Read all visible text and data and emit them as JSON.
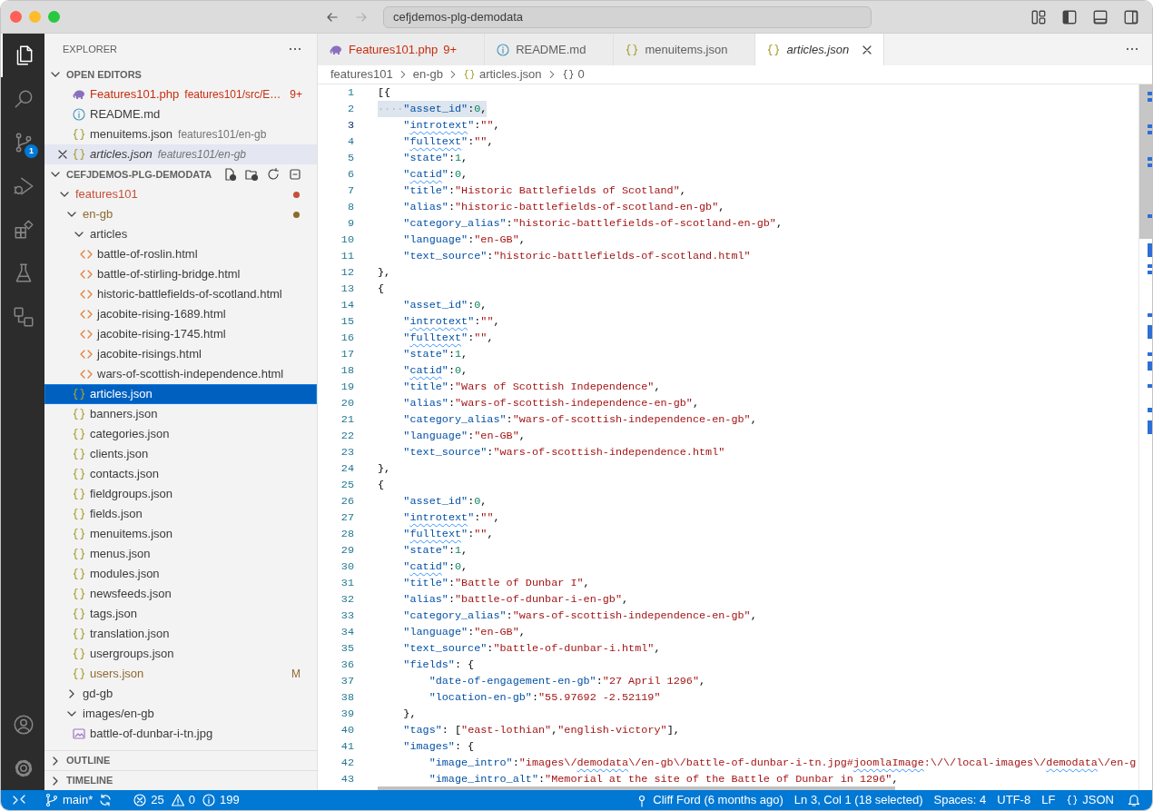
{
  "title_bar": {
    "back": {
      "disabled": false
    },
    "forward": {
      "disabled": true
    },
    "command_center": "cefjdemos-plg-demodata",
    "layout_controls": [
      {
        "kind": "customize",
        "on": false
      },
      {
        "kind": "primary-sidebar",
        "on": true
      },
      {
        "kind": "panel",
        "on": false
      },
      {
        "kind": "secondary-sidebar",
        "on": false
      }
    ]
  },
  "activity_bar": {
    "items": [
      {
        "kind": "explorer",
        "selected": true
      },
      {
        "kind": "search",
        "selected": false
      },
      {
        "kind": "source-control",
        "selected": false,
        "badge": "1"
      },
      {
        "kind": "run-debug",
        "selected": false
      },
      {
        "kind": "extensions",
        "selected": false
      },
      {
        "kind": "testing",
        "selected": false
      },
      {
        "kind": "remote-explorer",
        "selected": false
      }
    ],
    "bottom": [
      {
        "kind": "accounts"
      },
      {
        "kind": "manage"
      }
    ]
  },
  "sidebar": {
    "title": "EXPLORER",
    "open_editors": {
      "title": "OPEN EDITORS",
      "expanded": true,
      "items": [
        {
          "name": "Features101.php",
          "path": "features101/src/E…",
          "kind": "php",
          "badge": "9+",
          "color": "#c72e0f",
          "selected": false,
          "preview": false
        },
        {
          "name": "README.md",
          "kind": "info",
          "selected": false,
          "preview": false
        },
        {
          "name": "menuitems.json",
          "path": "features101/en-gb",
          "kind": "json",
          "selected": false,
          "preview": false
        },
        {
          "name": "articles.json",
          "path": "features101/en-gb",
          "kind": "json",
          "selected": true,
          "preview": true
        }
      ]
    },
    "folder": {
      "title": "CEFJDEMOS-PLG-DEMODATA",
      "expanded": true,
      "items": [
        {
          "label": "features101",
          "kind": "folder",
          "expanded": true,
          "selected": false,
          "color": "#c74e39",
          "children": [
            {
              "label": "en-gb",
              "kind": "folder",
              "expanded": true,
              "selected": false,
              "color": "#8f6a2d",
              "children": [
                {
                  "label": "articles",
                  "kind": "folder",
                  "expanded": true,
                  "selected": false,
                  "children": [
                    {
                      "label": "battle-of-roslin.html",
                      "kind": "html",
                      "selected": false
                    },
                    {
                      "label": "battle-of-stirling-bridge.html",
                      "kind": "html",
                      "selected": false
                    },
                    {
                      "label": "historic-battlefields-of-scotland.html",
                      "kind": "html",
                      "selected": false
                    },
                    {
                      "label": "jacobite-rising-1689.html",
                      "kind": "html",
                      "selected": false
                    },
                    {
                      "label": "jacobite-rising-1745.html",
                      "kind": "html",
                      "selected": false
                    },
                    {
                      "label": "jacobite-risings.html",
                      "kind": "html",
                      "selected": false
                    },
                    {
                      "label": "wars-of-scottish-independence.html",
                      "kind": "html",
                      "selected": false
                    }
                  ]
                },
                {
                  "label": "articles.json",
                  "kind": "json",
                  "selected": true
                },
                {
                  "label": "banners.json",
                  "kind": "json",
                  "selected": false
                },
                {
                  "label": "categories.json",
                  "kind": "json",
                  "selected": false
                },
                {
                  "label": "clients.json",
                  "kind": "json",
                  "selected": false
                },
                {
                  "label": "contacts.json",
                  "kind": "json",
                  "selected": false
                },
                {
                  "label": "fieldgroups.json",
                  "kind": "json",
                  "selected": false
                },
                {
                  "label": "fields.json",
                  "kind": "json",
                  "selected": false
                },
                {
                  "label": "menuitems.json",
                  "kind": "json",
                  "selected": false
                },
                {
                  "label": "menus.json",
                  "kind": "json",
                  "selected": false
                },
                {
                  "label": "modules.json",
                  "kind": "json",
                  "selected": false
                },
                {
                  "label": "newsfeeds.json",
                  "kind": "json",
                  "selected": false
                },
                {
                  "label": "tags.json",
                  "kind": "json",
                  "selected": false
                },
                {
                  "label": "translation.json",
                  "kind": "json",
                  "selected": false
                },
                {
                  "label": "usergroups.json",
                  "kind": "json",
                  "selected": false
                },
                {
                  "label": "users.json",
                  "kind": "json",
                  "selected": false,
                  "color": "#8f6a2d",
                  "badge": "M"
                }
              ]
            },
            {
              "label": "gd-gb",
              "kind": "folder",
              "expanded": false,
              "selected": false
            },
            {
              "label": "images/en-gb",
              "kind": "folder",
              "expanded": true,
              "selected": false,
              "children": [
                {
                  "label": "battle-of-dunbar-i-tn.jpg",
                  "kind": "image",
                  "selected": false
                }
              ]
            }
          ]
        }
      ]
    },
    "outline": {
      "title": "OUTLINE",
      "expanded": false
    },
    "timeline": {
      "title": "TIMELINE",
      "expanded": false
    }
  },
  "tabs": [
    {
      "name": "Features101.php",
      "kind": "php",
      "badge": "9+",
      "color": "#c72e0f",
      "selected": false,
      "preview": false
    },
    {
      "name": "README.md",
      "kind": "info",
      "selected": false,
      "preview": false
    },
    {
      "name": "menuitems.json",
      "kind": "json",
      "selected": false,
      "preview": false
    },
    {
      "name": "articles.json",
      "kind": "json",
      "selected": true,
      "preview": true
    }
  ],
  "breadcrumbs": [
    {
      "text": "features101",
      "kind": "folder"
    },
    {
      "text": "en-gb",
      "kind": "folder"
    },
    {
      "text": "articles.json",
      "kind": "json"
    },
    {
      "text": "0",
      "kind": "object"
    }
  ],
  "editor": {
    "lines": [
      {
        "number": "1",
        "selected": false,
        "current": false,
        "tokens": [
          {
            "text": "[{",
            "kind": "punct"
          }
        ]
      },
      {
        "number": "2",
        "selected": true,
        "current": false,
        "tokens": [
          {
            "text": "····",
            "kind": "whitespace"
          },
          {
            "text": "\"asset_id\"",
            "kind": "key"
          },
          {
            "text": ":",
            "kind": "punct"
          },
          {
            "text": "0",
            "kind": "number"
          },
          {
            "text": ",",
            "kind": "punct"
          }
        ]
      },
      {
        "number": "3",
        "selected": false,
        "current": true,
        "tokens": [
          {
            "text": "    \"",
            "kind": "key"
          },
          {
            "text": "introtext",
            "kind": "key",
            "spell": true
          },
          {
            "text": "\"",
            "kind": "key"
          },
          {
            "text": ":",
            "kind": "punct"
          },
          {
            "text": "\"\"",
            "kind": "string"
          },
          {
            "text": ",",
            "kind": "punct"
          }
        ]
      },
      {
        "number": "4",
        "selected": false,
        "current": false,
        "tokens": [
          {
            "text": "    \"",
            "kind": "key"
          },
          {
            "text": "fulltext",
            "kind": "key",
            "spell": true
          },
          {
            "text": "\"",
            "kind": "key"
          },
          {
            "text": ":",
            "kind": "punct"
          },
          {
            "text": "\"\"",
            "kind": "string"
          },
          {
            "text": ",",
            "kind": "punct"
          }
        ]
      },
      {
        "number": "5",
        "selected": false,
        "current": false,
        "tokens": [
          {
            "text": "    \"state\"",
            "kind": "key"
          },
          {
            "text": ":",
            "kind": "punct"
          },
          {
            "text": "1",
            "kind": "number"
          },
          {
            "text": ",",
            "kind": "punct"
          }
        ]
      },
      {
        "number": "6",
        "selected": false,
        "current": false,
        "tokens": [
          {
            "text": "    \"",
            "kind": "key"
          },
          {
            "text": "catid",
            "kind": "key",
            "spell": true
          },
          {
            "text": "\"",
            "kind": "key"
          },
          {
            "text": ":",
            "kind": "punct"
          },
          {
            "text": "0",
            "kind": "number"
          },
          {
            "text": ",",
            "kind": "punct"
          }
        ]
      },
      {
        "number": "7",
        "selected": false,
        "current": false,
        "tokens": [
          {
            "text": "    \"title\"",
            "kind": "key"
          },
          {
            "text": ":",
            "kind": "punct"
          },
          {
            "text": "\"Historic Battlefields of Scotland\"",
            "kind": "string"
          },
          {
            "text": ",",
            "kind": "punct"
          }
        ]
      },
      {
        "number": "8",
        "selected": false,
        "current": false,
        "tokens": [
          {
            "text": "    \"alias\"",
            "kind": "key"
          },
          {
            "text": ":",
            "kind": "punct"
          },
          {
            "text": "\"historic-battlefields-of-scotland-en-gb\"",
            "kind": "string"
          },
          {
            "text": ",",
            "kind": "punct"
          }
        ]
      },
      {
        "number": "9",
        "selected": false,
        "current": false,
        "tokens": [
          {
            "text": "    \"category_alias\"",
            "kind": "key"
          },
          {
            "text": ":",
            "kind": "punct"
          },
          {
            "text": "\"historic-battlefields-of-scotland-en-gb\"",
            "kind": "string"
          },
          {
            "text": ",",
            "kind": "punct"
          }
        ]
      },
      {
        "number": "10",
        "selected": false,
        "current": false,
        "tokens": [
          {
            "text": "    \"language\"",
            "kind": "key"
          },
          {
            "text": ":",
            "kind": "punct"
          },
          {
            "text": "\"en-GB\"",
            "kind": "string"
          },
          {
            "text": ",",
            "kind": "punct"
          }
        ]
      },
      {
        "number": "11",
        "selected": false,
        "current": false,
        "tokens": [
          {
            "text": "    \"text_source\"",
            "kind": "key"
          },
          {
            "text": ":",
            "kind": "punct"
          },
          {
            "text": "\"historic-battlefields-of-scotland.html\"",
            "kind": "string"
          }
        ]
      },
      {
        "number": "12",
        "selected": false,
        "current": false,
        "tokens": [
          {
            "text": "},",
            "kind": "punct"
          }
        ]
      },
      {
        "number": "13",
        "selected": false,
        "current": false,
        "tokens": [
          {
            "text": "{",
            "kind": "punct"
          }
        ]
      },
      {
        "number": "14",
        "selected": false,
        "current": false,
        "tokens": [
          {
            "text": "    \"asset_id\"",
            "kind": "key"
          },
          {
            "text": ":",
            "kind": "punct"
          },
          {
            "text": "0",
            "kind": "number"
          },
          {
            "text": ",",
            "kind": "punct"
          }
        ]
      },
      {
        "number": "15",
        "selected": false,
        "current": false,
        "tokens": [
          {
            "text": "    \"",
            "kind": "key"
          },
          {
            "text": "introtext",
            "kind": "key",
            "spell": true
          },
          {
            "text": "\"",
            "kind": "key"
          },
          {
            "text": ":",
            "kind": "punct"
          },
          {
            "text": "\"\"",
            "kind": "string"
          },
          {
            "text": ",",
            "kind": "punct"
          }
        ]
      },
      {
        "number": "16",
        "selected": false,
        "current": false,
        "tokens": [
          {
            "text": "    \"",
            "kind": "key"
          },
          {
            "text": "fulltext",
            "kind": "key",
            "spell": true
          },
          {
            "text": "\"",
            "kind": "key"
          },
          {
            "text": ":",
            "kind": "punct"
          },
          {
            "text": "\"\"",
            "kind": "string"
          },
          {
            "text": ",",
            "kind": "punct"
          }
        ]
      },
      {
        "number": "17",
        "selected": false,
        "current": false,
        "tokens": [
          {
            "text": "    \"state\"",
            "kind": "key"
          },
          {
            "text": ":",
            "kind": "punct"
          },
          {
            "text": "1",
            "kind": "number"
          },
          {
            "text": ",",
            "kind": "punct"
          }
        ]
      },
      {
        "number": "18",
        "selected": false,
        "current": false,
        "tokens": [
          {
            "text": "    \"",
            "kind": "key"
          },
          {
            "text": "catid",
            "kind": "key",
            "spell": true
          },
          {
            "text": "\"",
            "kind": "key"
          },
          {
            "text": ":",
            "kind": "punct"
          },
          {
            "text": "0",
            "kind": "number"
          },
          {
            "text": ",",
            "kind": "punct"
          }
        ]
      },
      {
        "number": "19",
        "selected": false,
        "current": false,
        "tokens": [
          {
            "text": "    \"title\"",
            "kind": "key"
          },
          {
            "text": ":",
            "kind": "punct"
          },
          {
            "text": "\"Wars of Scottish Independence\"",
            "kind": "string"
          },
          {
            "text": ",",
            "kind": "punct"
          }
        ]
      },
      {
        "number": "20",
        "selected": false,
        "current": false,
        "tokens": [
          {
            "text": "    \"alias\"",
            "kind": "key"
          },
          {
            "text": ":",
            "kind": "punct"
          },
          {
            "text": "\"wars-of-scottish-independence-en-gb\"",
            "kind": "string"
          },
          {
            "text": ",",
            "kind": "punct"
          }
        ]
      },
      {
        "number": "21",
        "selected": false,
        "current": false,
        "tokens": [
          {
            "text": "    \"category_alias\"",
            "kind": "key"
          },
          {
            "text": ":",
            "kind": "punct"
          },
          {
            "text": "\"wars-of-scottish-independence-en-gb\"",
            "kind": "string"
          },
          {
            "text": ",",
            "kind": "punct"
          }
        ]
      },
      {
        "number": "22",
        "selected": false,
        "current": false,
        "tokens": [
          {
            "text": "    \"language\"",
            "kind": "key"
          },
          {
            "text": ":",
            "kind": "punct"
          },
          {
            "text": "\"en-GB\"",
            "kind": "string"
          },
          {
            "text": ",",
            "kind": "punct"
          }
        ]
      },
      {
        "number": "23",
        "selected": false,
        "current": false,
        "tokens": [
          {
            "text": "    \"text_source\"",
            "kind": "key"
          },
          {
            "text": ":",
            "kind": "punct"
          },
          {
            "text": "\"wars-of-scottish-independence.html\"",
            "kind": "string"
          }
        ]
      },
      {
        "number": "24",
        "selected": false,
        "current": false,
        "tokens": [
          {
            "text": "},",
            "kind": "punct"
          }
        ]
      },
      {
        "number": "25",
        "selected": false,
        "current": false,
        "tokens": [
          {
            "text": "{",
            "kind": "punct"
          }
        ]
      },
      {
        "number": "26",
        "selected": false,
        "current": false,
        "tokens": [
          {
            "text": "    \"asset_id\"",
            "kind": "key"
          },
          {
            "text": ":",
            "kind": "punct"
          },
          {
            "text": "0",
            "kind": "number"
          },
          {
            "text": ",",
            "kind": "punct"
          }
        ]
      },
      {
        "number": "27",
        "selected": false,
        "current": false,
        "tokens": [
          {
            "text": "    \"",
            "kind": "key"
          },
          {
            "text": "introtext",
            "kind": "key",
            "spell": true
          },
          {
            "text": "\"",
            "kind": "key"
          },
          {
            "text": ":",
            "kind": "punct"
          },
          {
            "text": "\"\"",
            "kind": "string"
          },
          {
            "text": ",",
            "kind": "punct"
          }
        ]
      },
      {
        "number": "28",
        "selected": false,
        "current": false,
        "tokens": [
          {
            "text": "    \"",
            "kind": "key"
          },
          {
            "text": "fulltext",
            "kind": "key",
            "spell": true
          },
          {
            "text": "\"",
            "kind": "key"
          },
          {
            "text": ":",
            "kind": "punct"
          },
          {
            "text": "\"\"",
            "kind": "string"
          },
          {
            "text": ",",
            "kind": "punct"
          }
        ]
      },
      {
        "number": "29",
        "selected": false,
        "current": false,
        "tokens": [
          {
            "text": "    \"state\"",
            "kind": "key"
          },
          {
            "text": ":",
            "kind": "punct"
          },
          {
            "text": "1",
            "kind": "number"
          },
          {
            "text": ",",
            "kind": "punct"
          }
        ]
      },
      {
        "number": "30",
        "selected": false,
        "current": false,
        "tokens": [
          {
            "text": "    \"",
            "kind": "key"
          },
          {
            "text": "catid",
            "kind": "key",
            "spell": true
          },
          {
            "text": "\"",
            "kind": "key"
          },
          {
            "text": ":",
            "kind": "punct"
          },
          {
            "text": "0",
            "kind": "number"
          },
          {
            "text": ",",
            "kind": "punct"
          }
        ]
      },
      {
        "number": "31",
        "selected": false,
        "current": false,
        "tokens": [
          {
            "text": "    \"title\"",
            "kind": "key"
          },
          {
            "text": ":",
            "kind": "punct"
          },
          {
            "text": "\"Battle of Dunbar I\"",
            "kind": "string"
          },
          {
            "text": ",",
            "kind": "punct"
          }
        ]
      },
      {
        "number": "32",
        "selected": false,
        "current": false,
        "tokens": [
          {
            "text": "    \"alias\"",
            "kind": "key"
          },
          {
            "text": ":",
            "kind": "punct"
          },
          {
            "text": "\"battle-of-dunbar-i-en-gb\"",
            "kind": "string"
          },
          {
            "text": ",",
            "kind": "punct"
          }
        ]
      },
      {
        "number": "33",
        "selected": false,
        "current": false,
        "tokens": [
          {
            "text": "    \"category_alias\"",
            "kind": "key"
          },
          {
            "text": ":",
            "kind": "punct"
          },
          {
            "text": "\"wars-of-scottish-independence-en-gb\"",
            "kind": "string"
          },
          {
            "text": ",",
            "kind": "punct"
          }
        ]
      },
      {
        "number": "34",
        "selected": false,
        "current": false,
        "tokens": [
          {
            "text": "    \"language\"",
            "kind": "key"
          },
          {
            "text": ":",
            "kind": "punct"
          },
          {
            "text": "\"en-GB\"",
            "kind": "string"
          },
          {
            "text": ",",
            "kind": "punct"
          }
        ]
      },
      {
        "number": "35",
        "selected": false,
        "current": false,
        "tokens": [
          {
            "text": "    \"text_source\"",
            "kind": "key"
          },
          {
            "text": ":",
            "kind": "punct"
          },
          {
            "text": "\"battle-of-dunbar-i.html\"",
            "kind": "string"
          },
          {
            "text": ",",
            "kind": "punct"
          }
        ]
      },
      {
        "number": "36",
        "selected": false,
        "current": false,
        "tokens": [
          {
            "text": "    \"fields\"",
            "kind": "key"
          },
          {
            "text": ": {",
            "kind": "punct"
          }
        ]
      },
      {
        "number": "37",
        "selected": false,
        "current": false,
        "tokens": [
          {
            "text": "        \"date-of-engagement-en-gb\"",
            "kind": "key"
          },
          {
            "text": ":",
            "kind": "punct"
          },
          {
            "text": "\"27 April 1296\"",
            "kind": "string"
          },
          {
            "text": ",",
            "kind": "punct"
          }
        ]
      },
      {
        "number": "38",
        "selected": false,
        "current": false,
        "tokens": [
          {
            "text": "        \"location-en-gb\"",
            "kind": "key"
          },
          {
            "text": ":",
            "kind": "punct"
          },
          {
            "text": "\"55.97692 -2.52119\"",
            "kind": "string"
          }
        ]
      },
      {
        "number": "39",
        "selected": false,
        "current": false,
        "tokens": [
          {
            "text": "    },",
            "kind": "punct"
          }
        ]
      },
      {
        "number": "40",
        "selected": false,
        "current": false,
        "tokens": [
          {
            "text": "    \"tags\"",
            "kind": "key"
          },
          {
            "text": ": [",
            "kind": "punct"
          },
          {
            "text": "\"east-lothian\"",
            "kind": "string"
          },
          {
            "text": ",",
            "kind": "punct"
          },
          {
            "text": "\"english-victory\"",
            "kind": "string"
          },
          {
            "text": "],",
            "kind": "punct"
          }
        ]
      },
      {
        "number": "41",
        "selected": false,
        "current": false,
        "tokens": [
          {
            "text": "    \"images\"",
            "kind": "key"
          },
          {
            "text": ": {",
            "kind": "punct"
          }
        ]
      },
      {
        "number": "42",
        "selected": false,
        "current": false,
        "tokens": [
          {
            "text": "        \"image_intro\"",
            "kind": "key"
          },
          {
            "text": ":",
            "kind": "punct"
          },
          {
            "text": "\"images\\/",
            "kind": "string"
          },
          {
            "text": "demodata",
            "kind": "string",
            "spell": true
          },
          {
            "text": "\\/en-gb\\/battle-of-dunbar-i-tn.jpg#",
            "kind": "string"
          },
          {
            "text": "joomlaImage",
            "kind": "string",
            "spell": true
          },
          {
            "text": ":\\/\\/local-images\\/",
            "kind": "string"
          },
          {
            "text": "demodata",
            "kind": "string",
            "spell": true
          },
          {
            "text": "\\/en-g",
            "kind": "string"
          }
        ]
      },
      {
        "number": "43",
        "selected": false,
        "current": false,
        "tokens": [
          {
            "text": "        \"image_intro_alt\"",
            "kind": "key"
          },
          {
            "text": ":",
            "kind": "punct"
          },
          {
            "text": "\"Memorial at the site of the Battle of Dunbar in 1296\"",
            "kind": "string"
          },
          {
            "text": ",",
            "kind": "punct"
          }
        ]
      }
    ]
  },
  "status_bar": {
    "branch": "main*",
    "errors": "25",
    "warnings": "0",
    "infos": "199",
    "blame": "Cliff Ford (6 months ago)",
    "cursor": "Ln 3, Col 1 (18 selected)",
    "indentation": "Spaces: 4",
    "encoding": "UTF-8",
    "eol": "LF",
    "language": "JSON"
  }
}
